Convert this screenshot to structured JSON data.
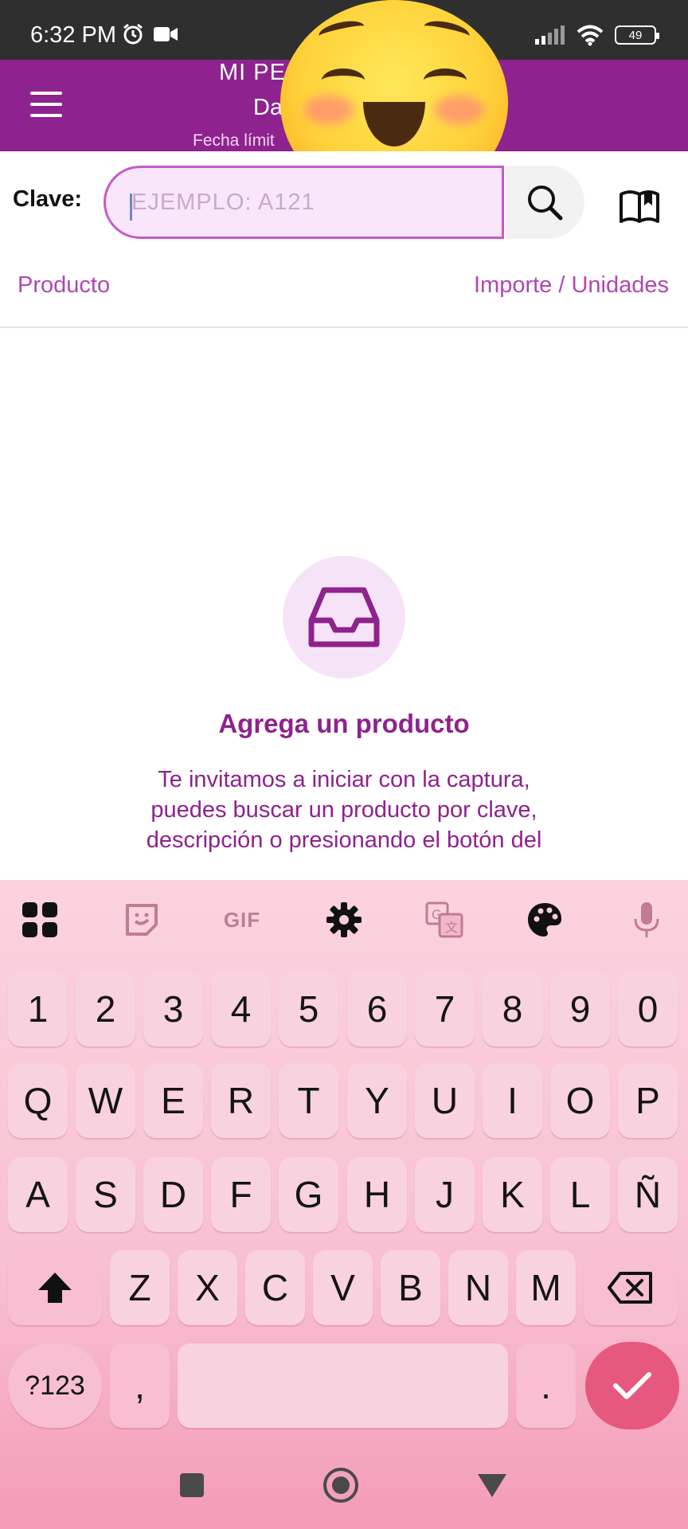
{
  "status_bar": {
    "time": "6:32 PM",
    "battery": "49",
    "icons": [
      "alarm-icon",
      "video-icon",
      "signal-icon",
      "wifi-icon",
      "battery-icon"
    ]
  },
  "header": {
    "title": "MI PE",
    "subtitle": "Da",
    "deadline": "Fecha límit",
    "menu_icon": "hamburger-menu-icon"
  },
  "search": {
    "label": "Clave:",
    "placeholder": "EJEMPLO: A121",
    "value": "",
    "search_icon": "magnifier-icon",
    "catalog_icon": "open-book-icon"
  },
  "columns": {
    "product": "Producto",
    "amount": "Importe / Unidades"
  },
  "empty_state": {
    "icon": "inbox-tray-icon",
    "title": "Agrega un producto",
    "description": "Te invitamos a iniciar con la captura, puedes buscar un producto por clave, descripción o presionando el botón del"
  },
  "keyboard": {
    "toolbar": [
      "apps-grid-icon",
      "sticker-icon",
      "GIF",
      "settings-gear-icon",
      "translate-icon",
      "palette-icon",
      "microphone-icon"
    ],
    "gif_label": "GIF",
    "rows": [
      [
        "1",
        "2",
        "3",
        "4",
        "5",
        "6",
        "7",
        "8",
        "9",
        "0"
      ],
      [
        "Q",
        "W",
        "E",
        "R",
        "T",
        "Y",
        "U",
        "I",
        "O",
        "P"
      ],
      [
        "A",
        "S",
        "D",
        "F",
        "G",
        "H",
        "J",
        "K",
        "L",
        "Ñ"
      ],
      [
        "Z",
        "X",
        "C",
        "V",
        "B",
        "N",
        "M"
      ]
    ],
    "symbols_label": "?123",
    "comma": ",",
    "period": ".",
    "shift_icon": "shift-arrow-icon",
    "backspace_icon": "backspace-icon",
    "enter_icon": "checkmark-icon"
  },
  "colors": {
    "brand": "#8e228e",
    "accent": "#b046b4",
    "keyboard_bg": "#f8c0d2",
    "enter": "#e7587f"
  }
}
